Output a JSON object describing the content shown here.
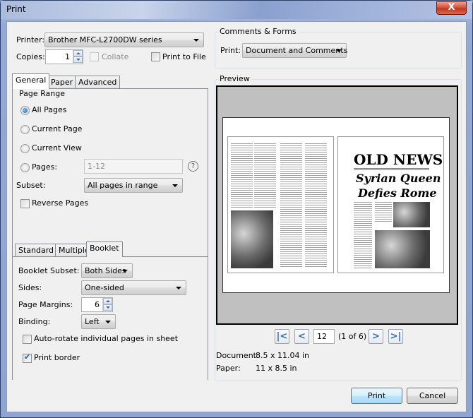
{
  "window": {
    "title": "Print",
    "close_label": "X"
  },
  "printer": {
    "label": "Printer:",
    "value": "Brother MFC-L2700DW series"
  },
  "copies": {
    "label": "Copies:",
    "value": "1",
    "collate_label": "Collate",
    "collate_checked": false,
    "collate_disabled": true
  },
  "print_to_file": {
    "label": "Print to File",
    "checked": false
  },
  "comments_forms": {
    "title": "Comments & Forms",
    "print_label": "Print:",
    "print_value": "Document and Comments"
  },
  "tabs": [
    {
      "label": "General",
      "active": true
    },
    {
      "label": "Paper"
    },
    {
      "label": "Advanced"
    }
  ],
  "page_range": {
    "title": "Page Range",
    "options": [
      {
        "label": "All Pages",
        "selected": true
      },
      {
        "label": "Current Page",
        "selected": false
      },
      {
        "label": "Current View",
        "selected": false
      },
      {
        "label": "Pages:",
        "selected": false
      }
    ],
    "pages_value": "1-12",
    "help_icon": "?",
    "subset_label": "Subset:",
    "subset_value": "All pages in range",
    "reverse_label": "Reverse Pages",
    "reverse_checked": false
  },
  "layout_tabs": [
    {
      "label": "Standard"
    },
    {
      "label": "Multiple"
    },
    {
      "label": "Booklet",
      "active": true
    }
  ],
  "booklet": {
    "subset_label": "Booklet Subset:",
    "subset_value": "Both Sides",
    "sides_label": "Sides:",
    "sides_value": "One-sided",
    "margins_label": "Page Margins:",
    "margins_value": "6",
    "binding_label": "Binding:",
    "binding_value": "Left",
    "autorotate_label": "Auto-rotate individual pages in sheet",
    "autorotate_checked": false,
    "border_label": "Print border",
    "border_checked": true
  },
  "preview": {
    "title": "Preview",
    "newspaper_title": "OLD NEWS",
    "headline_1": "Syrian Queen",
    "headline_2": "Defies Rome",
    "page_input": "12",
    "page_status": "(1 of 6)",
    "document_label": "Document:",
    "document_value": "8.5 x 11.04 in",
    "paper_label": "Paper:",
    "paper_value": "11 x 8.5 in"
  },
  "buttons": {
    "print": "Print",
    "cancel": "Cancel"
  }
}
